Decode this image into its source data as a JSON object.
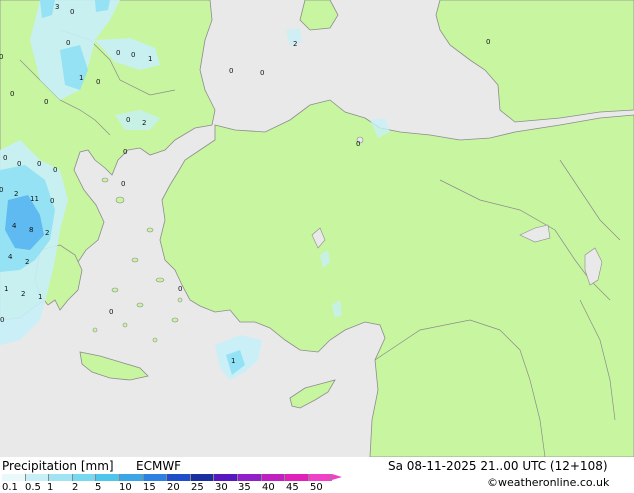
{
  "map": {
    "precip_labels": [
      "3",
      "0",
      "2",
      "0",
      "0",
      "1",
      "1",
      "0",
      "0",
      "0",
      "0",
      "0",
      "0",
      "0",
      "0",
      "2",
      "0",
      "0",
      "0",
      "0",
      "0",
      "11",
      "0",
      "4",
      "8",
      "2",
      "4",
      "2",
      "1",
      "2",
      "1",
      "0",
      "0",
      "0",
      "1",
      "0",
      "2",
      "0",
      "0",
      "0"
    ],
    "colors": {
      "sea": "#e9e9e9",
      "land": "#c8f5a0",
      "coast": "#8c8c8c",
      "precip_light": "#c8f0f8",
      "precip_mid": "#8ee0f4",
      "precip_heavy": "#50b0ef"
    }
  },
  "footer": {
    "title": "Precipitation [mm]",
    "model": "ECMWF",
    "datetime": "Sa 08-11-2025 21..00 UTC (12+108)",
    "credit": "©weatheronline.co.uk",
    "scale_labels": [
      "0.1",
      "0.5",
      "1",
      "2",
      "5",
      "10",
      "15",
      "20",
      "25",
      "30",
      "35",
      "40",
      "45",
      "50"
    ],
    "scale_colors": [
      "#e8f8fb",
      "#c6eff7",
      "#a0e4f4",
      "#78d8f0",
      "#4ec6ec",
      "#3aa6e6",
      "#2d7fe0",
      "#1f4ec8",
      "#1a2ea0",
      "#5818c0",
      "#9020c8",
      "#c020c0",
      "#e020b8",
      "#f040c8"
    ]
  }
}
